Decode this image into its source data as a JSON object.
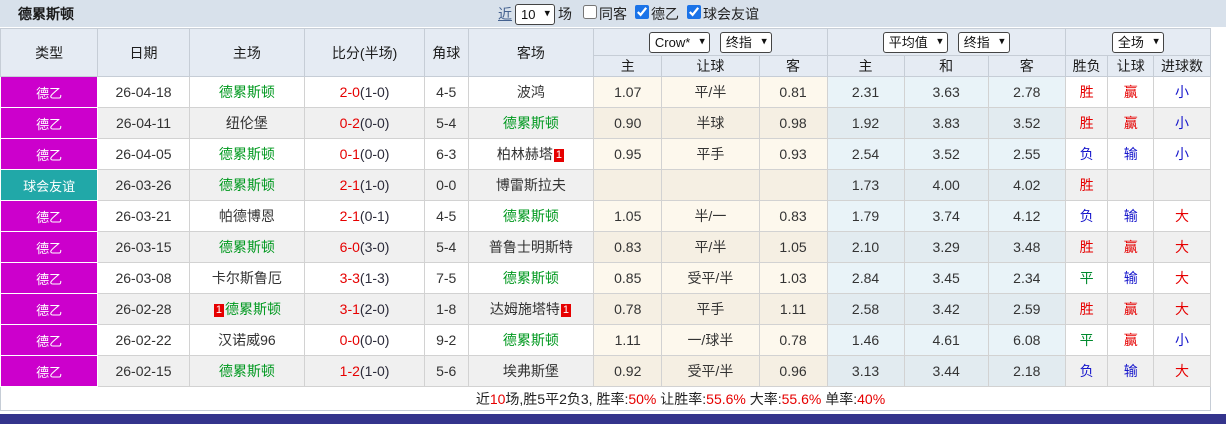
{
  "title": "德累斯顿",
  "filters": {
    "recent_label": "近",
    "recent_value": "10",
    "games_label": "场",
    "checkboxes": [
      {
        "label": "同客",
        "checked": false
      },
      {
        "label": "德乙",
        "checked": true
      },
      {
        "label": "球会友谊",
        "checked": true
      }
    ]
  },
  "header": {
    "left_columns": [
      "类型",
      "日期",
      "主场",
      "比分(半场)",
      "角球",
      "客场"
    ],
    "odds_group": {
      "select1": "Crow*",
      "select2": "终指",
      "subcols": [
        "主",
        "让球",
        "客"
      ]
    },
    "avg_group": {
      "select1": "平均值",
      "select2": "终指",
      "subcols": [
        "主",
        "和",
        "客"
      ]
    },
    "result_group": {
      "select": "全场",
      "subcols": [
        "胜负",
        "让球",
        "进球数"
      ]
    }
  },
  "colors": {
    "league_magenta": "#cc00cc",
    "friendly_teal": "#21a8a8",
    "win_red": "#e60000",
    "lose_blue": "#1616cc",
    "draw_green": "#008a2e",
    "team_green": "#00991f",
    "navy_bar": "#34348c"
  },
  "rows": [
    {
      "type": "德乙",
      "type_color": "#cc00cc",
      "date": "26-04-18",
      "home": {
        "name": "德累斯顿",
        "green": true,
        "badge": ""
      },
      "score": "2-0",
      "half": "(1-0)",
      "corner": "4-5",
      "away": {
        "name": "波鸿",
        "green": false,
        "badge": ""
      },
      "odds": [
        "1.07",
        "平/半",
        "0.81"
      ],
      "avg": [
        "2.31",
        "3.63",
        "2.78"
      ],
      "results": [
        {
          "t": "胜",
          "c": "r"
        },
        {
          "t": "赢",
          "c": "r"
        },
        {
          "t": "小",
          "c": "b"
        }
      ]
    },
    {
      "type": "德乙",
      "type_color": "#cc00cc",
      "date": "26-04-11",
      "home": {
        "name": "纽伦堡",
        "green": false,
        "badge": ""
      },
      "score": "0-2",
      "half": "(0-0)",
      "corner": "5-4",
      "away": {
        "name": "德累斯顿",
        "green": true,
        "badge": ""
      },
      "odds": [
        "0.90",
        "半球",
        "0.98"
      ],
      "avg": [
        "1.92",
        "3.83",
        "3.52"
      ],
      "results": [
        {
          "t": "胜",
          "c": "r"
        },
        {
          "t": "赢",
          "c": "r"
        },
        {
          "t": "小",
          "c": "b"
        }
      ]
    },
    {
      "type": "德乙",
      "type_color": "#cc00cc",
      "date": "26-04-05",
      "home": {
        "name": "德累斯顿",
        "green": true,
        "badge": ""
      },
      "score": "0-1",
      "half": "(0-0)",
      "corner": "6-3",
      "away": {
        "name": "柏林赫塔",
        "green": false,
        "badge": "1"
      },
      "odds": [
        "0.95",
        "平手",
        "0.93"
      ],
      "avg": [
        "2.54",
        "3.52",
        "2.55"
      ],
      "results": [
        {
          "t": "负",
          "c": "b"
        },
        {
          "t": "输",
          "c": "b"
        },
        {
          "t": "小",
          "c": "b"
        }
      ]
    },
    {
      "type": "球会友谊",
      "type_color": "#21a8a8",
      "date": "26-03-26",
      "home": {
        "name": "德累斯顿",
        "green": true,
        "badge": ""
      },
      "score": "2-1",
      "half": "(1-0)",
      "corner": "0-0",
      "away": {
        "name": "博雷斯拉夫",
        "green": false,
        "badge": ""
      },
      "odds": [
        "",
        "",
        ""
      ],
      "avg": [
        "1.73",
        "4.00",
        "4.02"
      ],
      "results": [
        {
          "t": "胜",
          "c": "r"
        },
        {
          "t": "",
          "c": ""
        },
        {
          "t": "",
          "c": ""
        }
      ]
    },
    {
      "type": "德乙",
      "type_color": "#cc00cc",
      "date": "26-03-21",
      "home": {
        "name": "帕德博恩",
        "green": false,
        "badge": ""
      },
      "score": "2-1",
      "half": "(0-1)",
      "corner": "4-5",
      "away": {
        "name": "德累斯顿",
        "green": true,
        "badge": ""
      },
      "odds": [
        "1.05",
        "半/一",
        "0.83"
      ],
      "avg": [
        "1.79",
        "3.74",
        "4.12"
      ],
      "results": [
        {
          "t": "负",
          "c": "b"
        },
        {
          "t": "输",
          "c": "b"
        },
        {
          "t": "大",
          "c": "r"
        }
      ]
    },
    {
      "type": "德乙",
      "type_color": "#cc00cc",
      "date": "26-03-15",
      "home": {
        "name": "德累斯顿",
        "green": true,
        "badge": ""
      },
      "score": "6-0",
      "half": "(3-0)",
      "corner": "5-4",
      "away": {
        "name": "普鲁士明斯特",
        "green": false,
        "badge": ""
      },
      "odds": [
        "0.83",
        "平/半",
        "1.05"
      ],
      "avg": [
        "2.10",
        "3.29",
        "3.48"
      ],
      "results": [
        {
          "t": "胜",
          "c": "r"
        },
        {
          "t": "赢",
          "c": "r"
        },
        {
          "t": "大",
          "c": "r"
        }
      ]
    },
    {
      "type": "德乙",
      "type_color": "#cc00cc",
      "date": "26-03-08",
      "home": {
        "name": "卡尔斯鲁厄",
        "green": false,
        "badge": ""
      },
      "score": "3-3",
      "half": "(1-3)",
      "corner": "7-5",
      "away": {
        "name": "德累斯顿",
        "green": true,
        "badge": ""
      },
      "odds": [
        "0.85",
        "受平/半",
        "1.03"
      ],
      "avg": [
        "2.84",
        "3.45",
        "2.34"
      ],
      "results": [
        {
          "t": "平",
          "c": "g"
        },
        {
          "t": "输",
          "c": "b"
        },
        {
          "t": "大",
          "c": "r"
        }
      ]
    },
    {
      "type": "德乙",
      "type_color": "#cc00cc",
      "date": "26-02-28",
      "home": {
        "name": "德累斯顿",
        "green": true,
        "badge": "1",
        "badge_before": true
      },
      "score": "3-1",
      "half": "(2-0)",
      "corner": "1-8",
      "away": {
        "name": "达姆施塔特",
        "green": false,
        "badge": "1"
      },
      "odds": [
        "0.78",
        "平手",
        "1.11"
      ],
      "avg": [
        "2.58",
        "3.42",
        "2.59"
      ],
      "results": [
        {
          "t": "胜",
          "c": "r"
        },
        {
          "t": "赢",
          "c": "r"
        },
        {
          "t": "大",
          "c": "r"
        }
      ]
    },
    {
      "type": "德乙",
      "type_color": "#cc00cc",
      "date": "26-02-22",
      "home": {
        "name": "汉诺威96",
        "green": false,
        "badge": ""
      },
      "score": "0-0",
      "half": "(0-0)",
      "corner": "9-2",
      "away": {
        "name": "德累斯顿",
        "green": true,
        "badge": ""
      },
      "odds": [
        "1.11",
        "一/球半",
        "0.78"
      ],
      "avg": [
        "1.46",
        "4.61",
        "6.08"
      ],
      "results": [
        {
          "t": "平",
          "c": "g"
        },
        {
          "t": "赢",
          "c": "r"
        },
        {
          "t": "小",
          "c": "b"
        }
      ]
    },
    {
      "type": "德乙",
      "type_color": "#cc00cc",
      "date": "26-02-15",
      "home": {
        "name": "德累斯顿",
        "green": true,
        "badge": ""
      },
      "score": "1-2",
      "half": "(1-0)",
      "corner": "5-6",
      "away": {
        "name": "埃弗斯堡",
        "green": false,
        "badge": ""
      },
      "odds": [
        "0.92",
        "受平/半",
        "0.96"
      ],
      "avg": [
        "3.13",
        "3.44",
        "2.18"
      ],
      "results": [
        {
          "t": "负",
          "c": "b"
        },
        {
          "t": "输",
          "c": "b"
        },
        {
          "t": "大",
          "c": "r"
        }
      ]
    }
  ],
  "footer": {
    "segments": [
      {
        "t": "近",
        "red": false
      },
      {
        "t": "10",
        "red": true
      },
      {
        "t": "场,胜5平2负3, 胜率:",
        "red": false
      },
      {
        "t": "50%",
        "red": true
      },
      {
        "t": " 让胜率:",
        "red": false
      },
      {
        "t": "55.6%",
        "red": true
      },
      {
        "t": " 大率:",
        "red": false
      },
      {
        "t": "55.6%",
        "red": true
      },
      {
        "t": " 单率:",
        "red": false
      },
      {
        "t": "40%",
        "red": true
      }
    ]
  }
}
